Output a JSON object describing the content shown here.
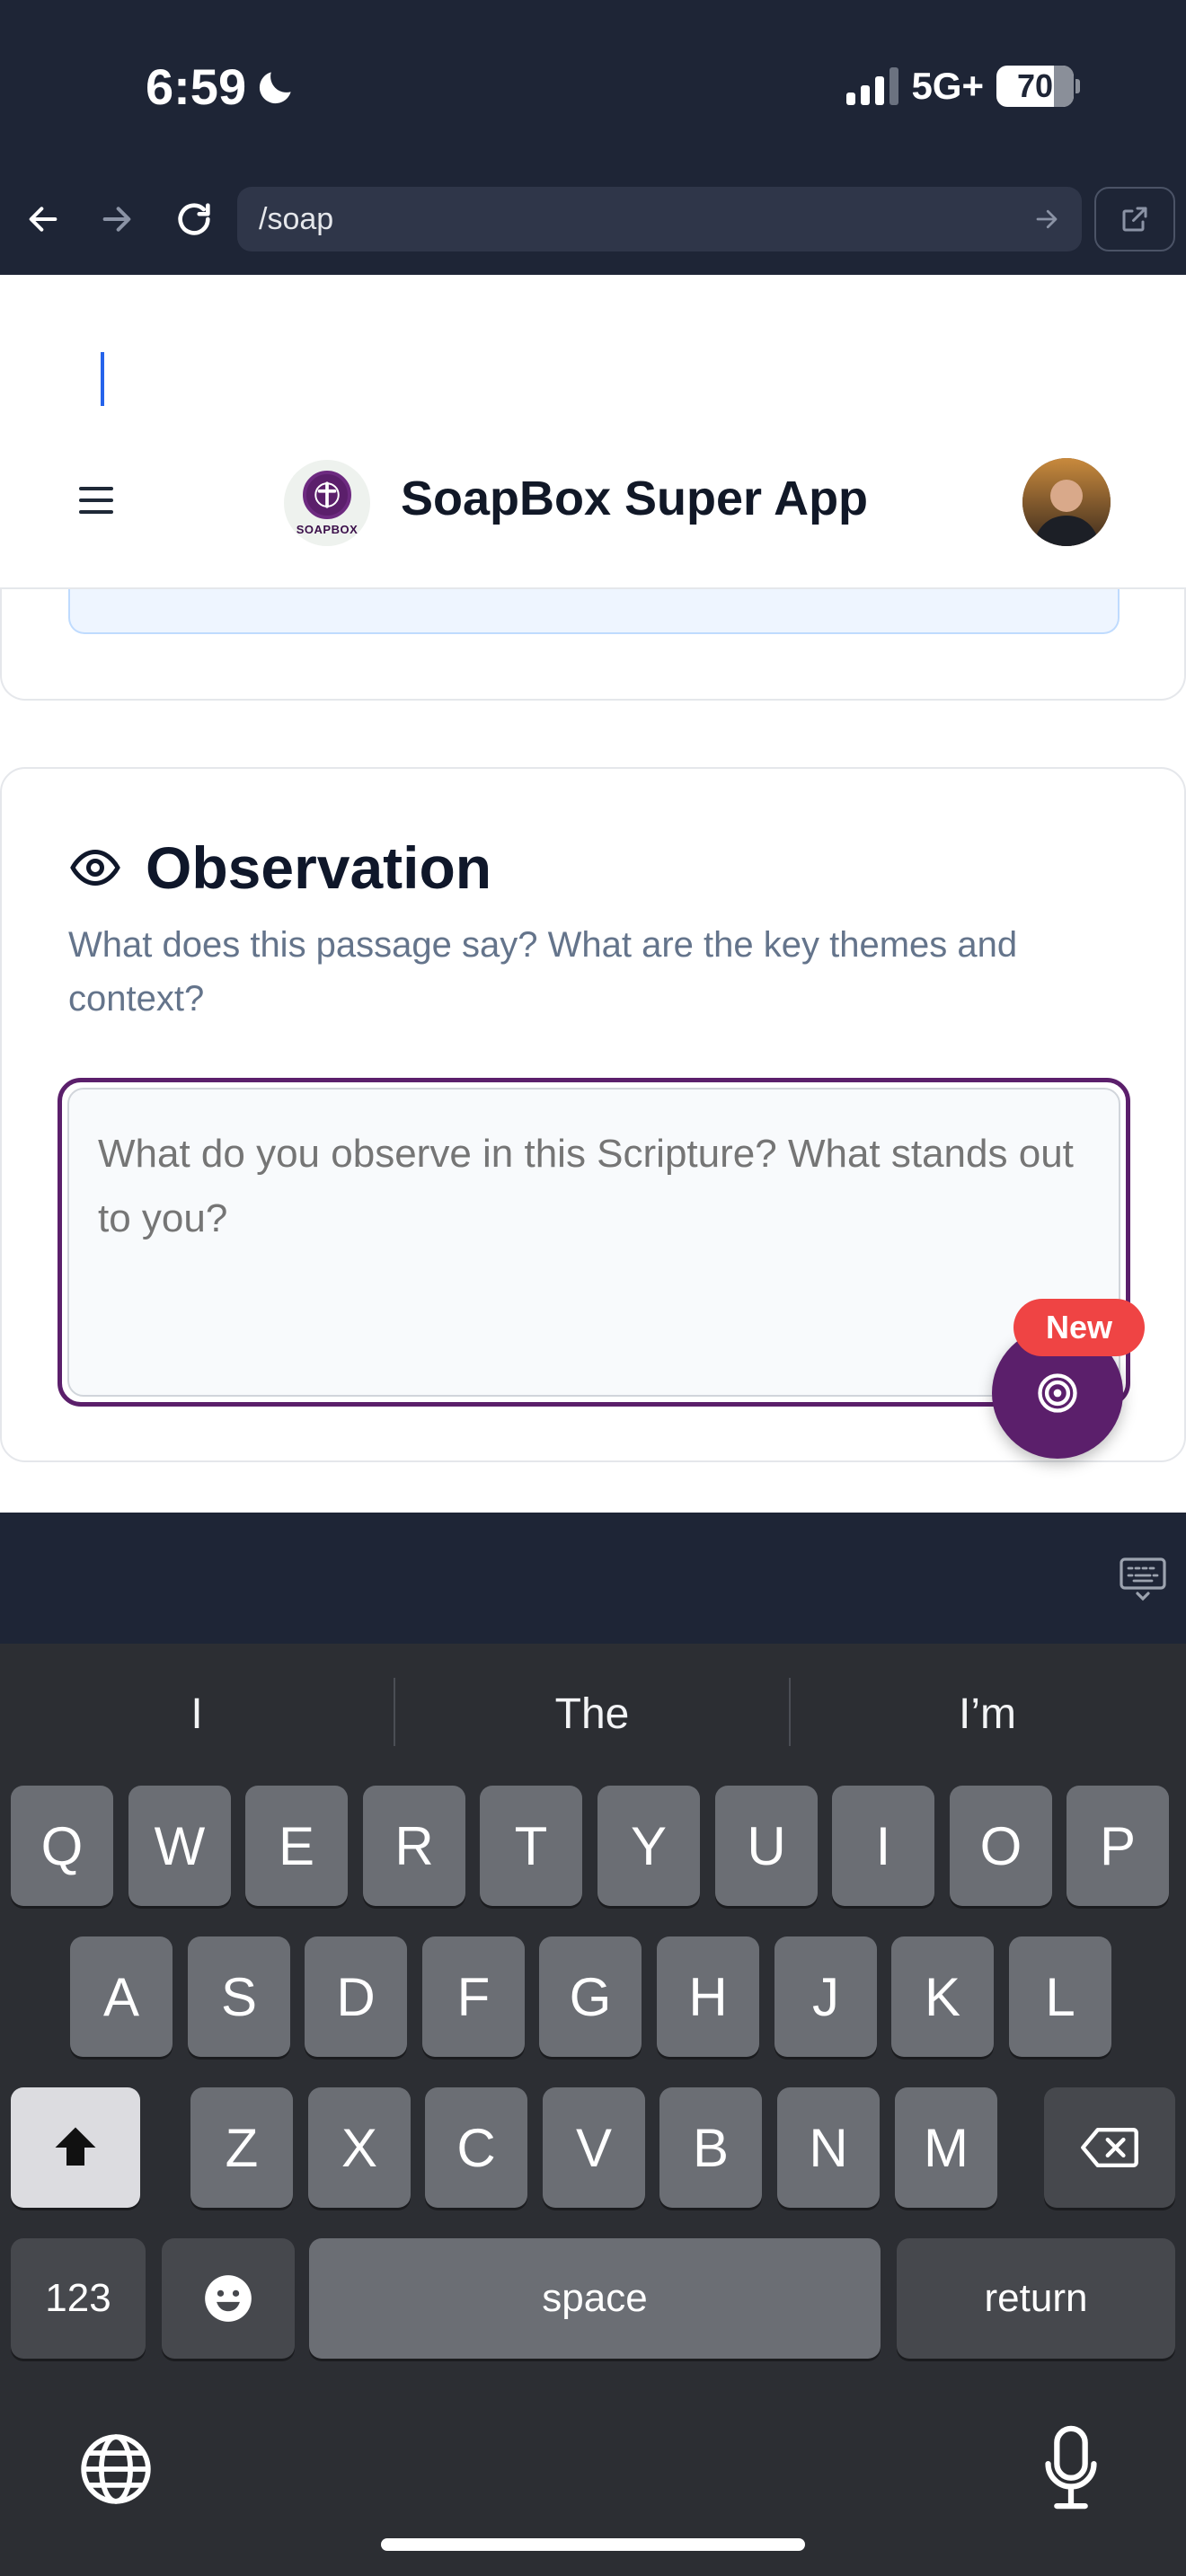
{
  "status_bar": {
    "time": "6:59",
    "network": "5G+",
    "battery": "70"
  },
  "browser": {
    "url": "/soap"
  },
  "app": {
    "logo_text": "SOAPBOX",
    "title": "SoapBox Super App"
  },
  "observation": {
    "title": "Observation",
    "subtitle": "What does this passage say? What are the key themes and context?",
    "placeholder": "What do you observe in this Scripture? What stands out to you?",
    "badge": "New"
  },
  "keyboard": {
    "suggestions": [
      "I",
      "The",
      "I’m"
    ],
    "row1": [
      "Q",
      "W",
      "E",
      "R",
      "T",
      "Y",
      "U",
      "I",
      "O",
      "P"
    ],
    "row2": [
      "A",
      "S",
      "D",
      "F",
      "G",
      "H",
      "J",
      "K",
      "L"
    ],
    "row3": [
      "Z",
      "X",
      "C",
      "V",
      "B",
      "N",
      "M"
    ],
    "numbers_key": "123",
    "space_key": "space",
    "return_key": "return"
  },
  "colors": {
    "brand": "#5b1f6b",
    "badge": "#ef4444",
    "chrome": "#1e2536",
    "keyboard": "#2c2e33"
  }
}
